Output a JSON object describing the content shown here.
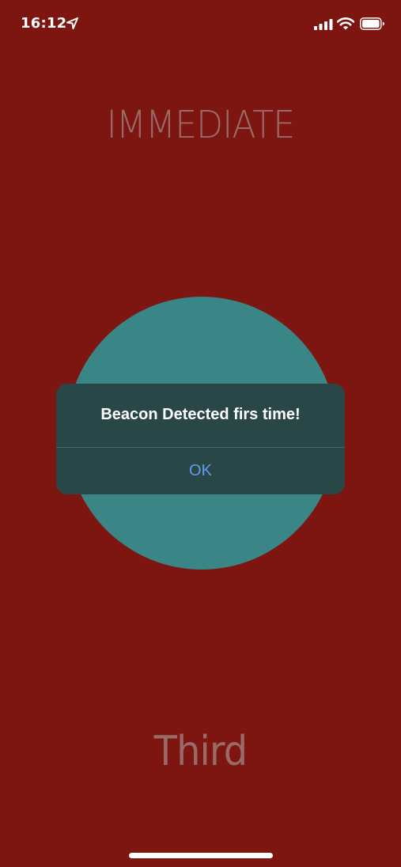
{
  "status_bar": {
    "time": "16:12",
    "icons": [
      "location-arrow-icon",
      "cellular-signal-icon",
      "wifi-icon",
      "battery-icon"
    ]
  },
  "screen": {
    "proximity": "IMMEDIATE",
    "region": "Third"
  },
  "alert": {
    "title": "Beacon Detected firs time!",
    "ok_label": "OK"
  },
  "colors": {
    "background": "#7d1610",
    "circle": "#3a8687",
    "label_text": "#9a6a68",
    "alert_background": "#294746",
    "alert_button": "#5d9fec"
  }
}
